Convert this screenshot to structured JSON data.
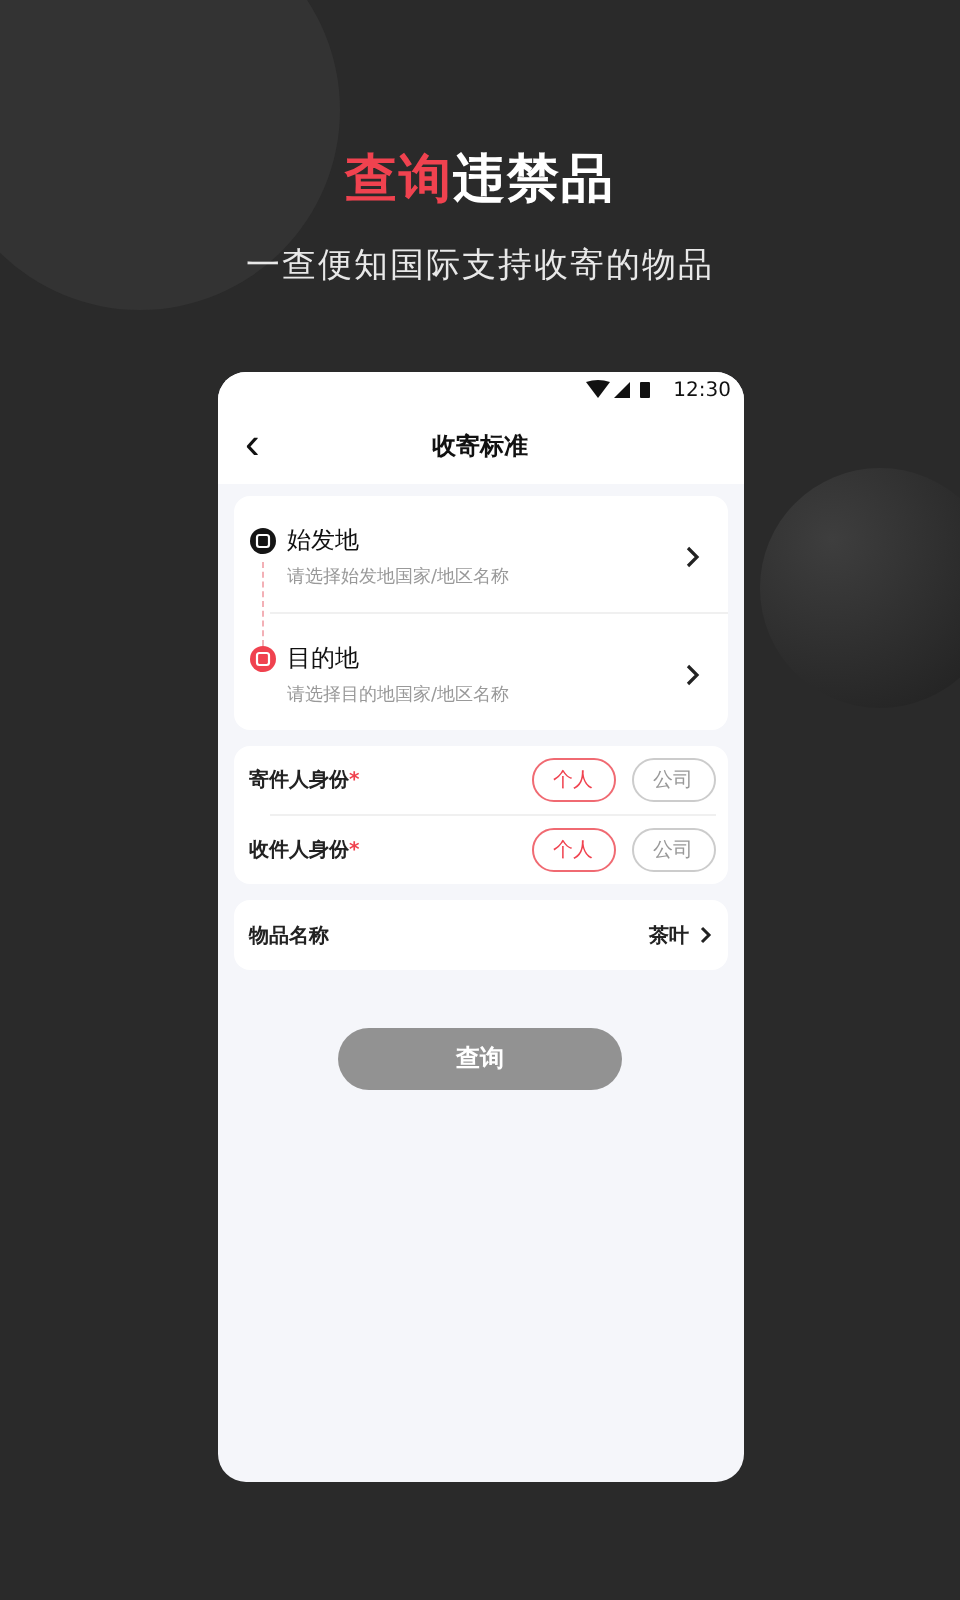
{
  "headline": {
    "highlight": "查询",
    "rest": "违禁品"
  },
  "subtitle": "一查便知国际支持收寄的物品",
  "status_bar": {
    "time": "12:30"
  },
  "header": {
    "back": "‹",
    "title": "收寄标准"
  },
  "route": [
    {
      "kind": "origin",
      "title": "始发地",
      "placeholder": "请选择始发地国家/地区名称"
    },
    {
      "kind": "destination",
      "title": "目的地",
      "placeholder": "请选择目的地国家/地区名称"
    }
  ],
  "identities": [
    {
      "label": "寄件人身份",
      "required_mark": "*",
      "options": [
        {
          "label": "个人",
          "selected": true
        },
        {
          "label": "公司",
          "selected": false
        }
      ]
    },
    {
      "label": "收件人身份",
      "required_mark": "*",
      "options": [
        {
          "label": "个人",
          "selected": true
        },
        {
          "label": "公司",
          "selected": false
        }
      ]
    }
  ],
  "item": {
    "label": "物品名称",
    "value": "茶叶"
  },
  "query_button": {
    "label": "查询",
    "disabled": true
  }
}
